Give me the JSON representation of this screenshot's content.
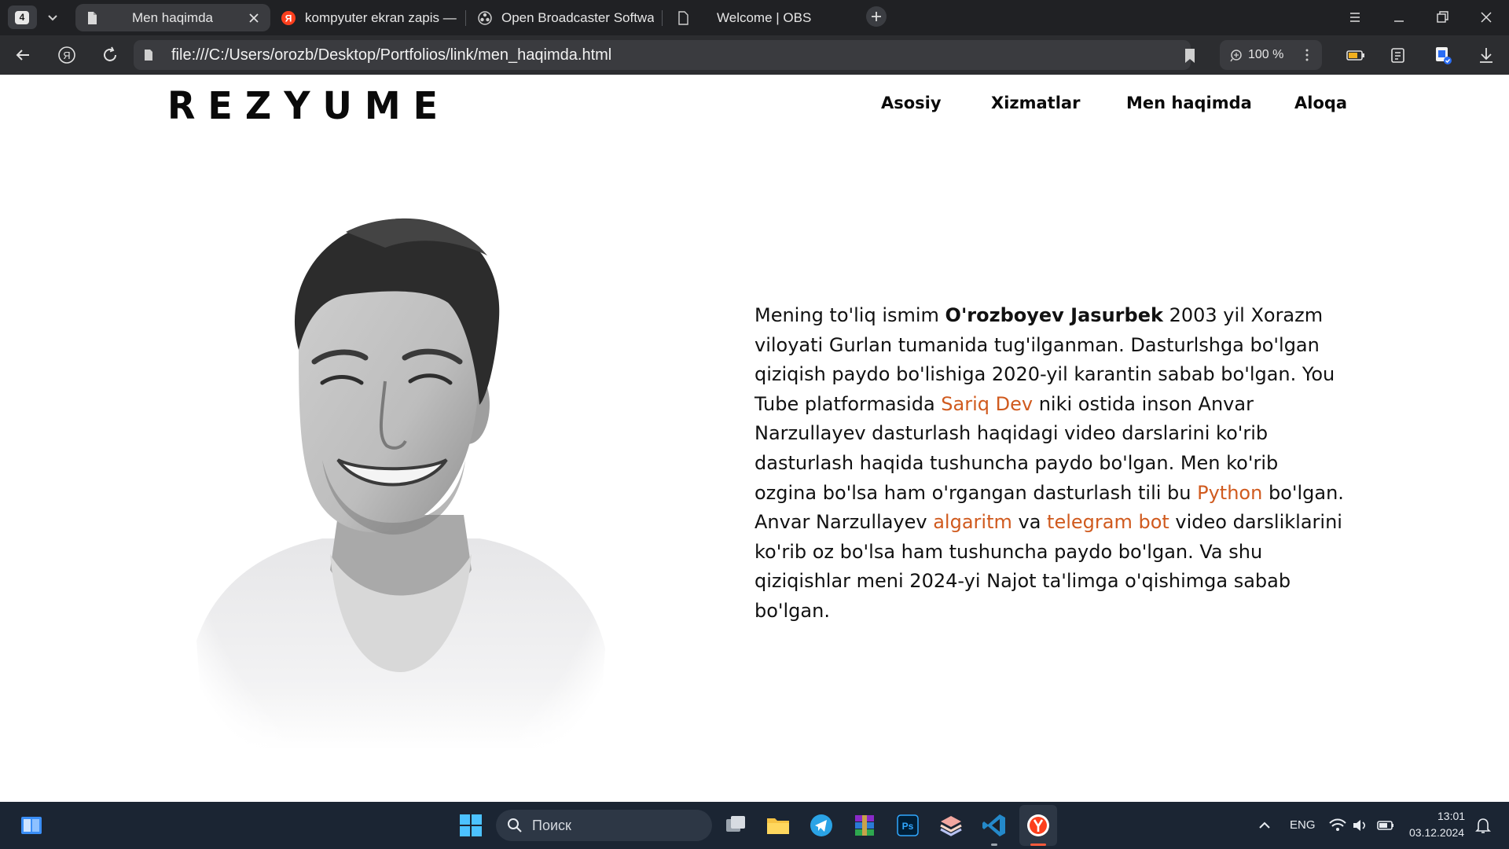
{
  "browser": {
    "tab_count": "4",
    "tabs": [
      {
        "label": "Men haqimda",
        "active": true
      },
      {
        "label": "kompyuter ekran zapis — ",
        "active": false
      },
      {
        "label": "Open Broadcaster Softwa",
        "active": false
      },
      {
        "label": "Welcome | OBS",
        "active": false
      }
    ],
    "address": "file:///C:/Users/orozb/Desktop/Portfolios/link/men_haqimda.html",
    "zoom": "100 %"
  },
  "site": {
    "logo": "REZYUME",
    "nav": [
      "Asosiy",
      "Xizmatlar",
      "Men haqimda",
      "Aloqa"
    ],
    "bio": {
      "p1": "Mening to'liq ismim ",
      "name": "O'rozboyev Jasurbek",
      "p2": " 2003 yil Xorazm viloyati Gurlan tumanida tug'ilganman. Dasturlshga bo'lgan qiziqish paydo bo'lishiga 2020-yil karantin sabab bo'lgan. You Tube platformasida ",
      "link1": "Sariq Dev",
      "p3": " niki ostida inson Anvar Narzullayev dasturlash haqidagi video darslarini ko'rib dasturlash haqida tushuncha paydo bo'lgan. Men ko'rib ozgina bo'lsa ham o'rgangan dasturlash tili bu ",
      "link2": "Python",
      "p4": " bo'lgan. Anvar Narzullayev ",
      "link3": "algaritm",
      "p5": " va ",
      "link4": "telegram bot",
      "p6": " video darsliklarini ko'rib oz bo'lsa ham tushuncha paydo bo'lgan. Va shu qiziqishlar meni 2024-yi Najot ta'limga o'qishimga sabab bo'lgan."
    }
  },
  "taskbar": {
    "search_placeholder": "Поиск",
    "lang": "ENG",
    "time": "13:01",
    "date": "03.12.2024"
  },
  "colors": {
    "link": "#d05a1e",
    "browser_bg": "#202124",
    "taskbar_bg": "#1b2533"
  }
}
